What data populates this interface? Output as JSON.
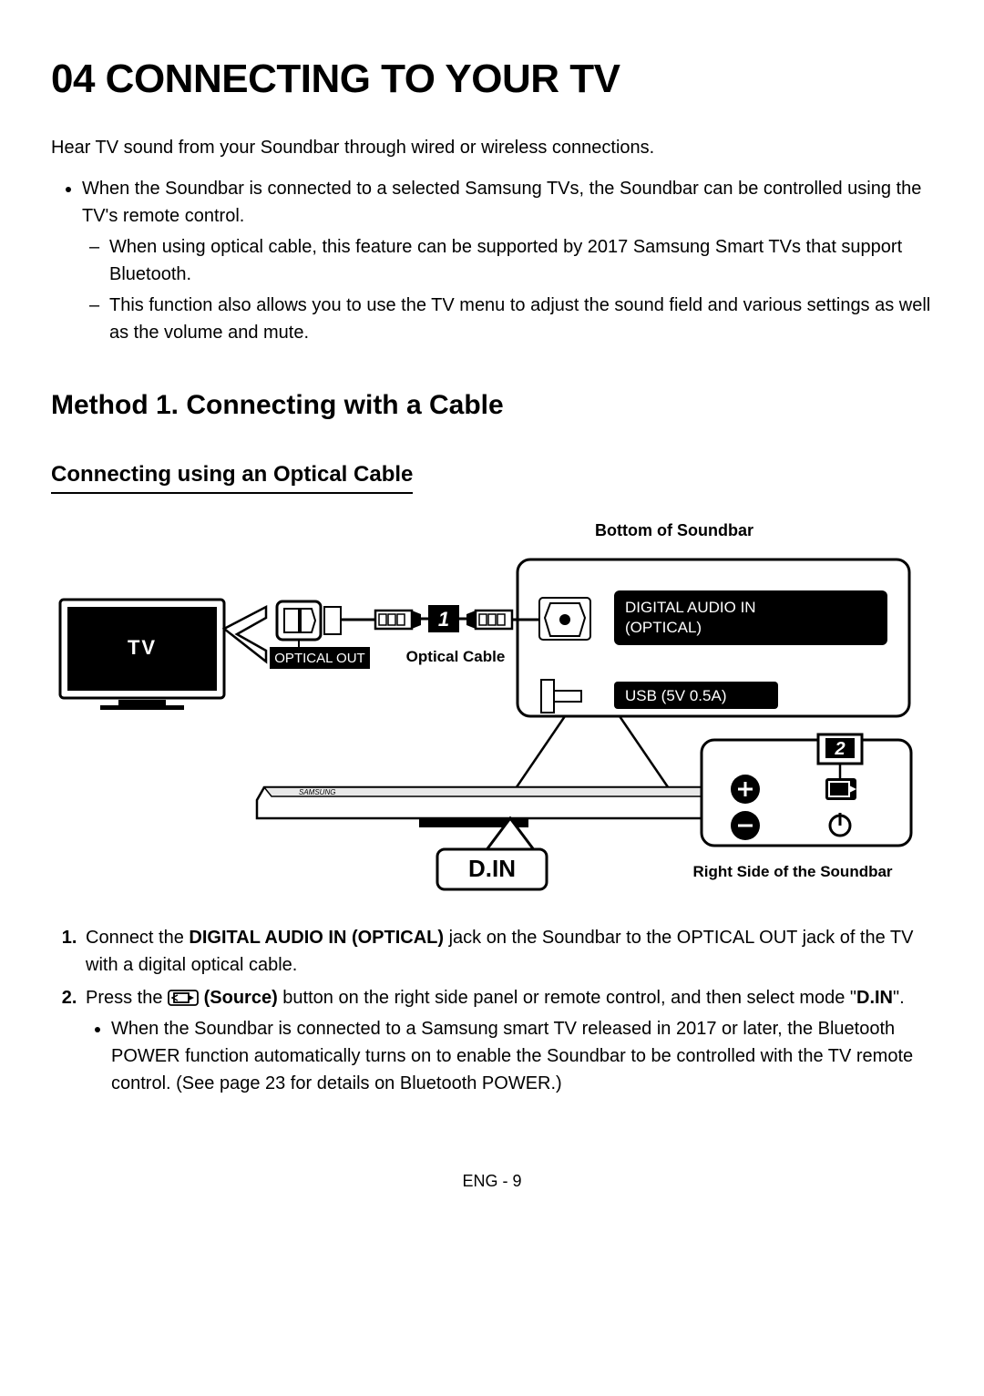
{
  "title": "04   CONNECTING TO YOUR TV",
  "intro": "Hear TV sound from your Soundbar through wired or wireless connections.",
  "bullets": {
    "main": "When the Soundbar is connected to a selected Samsung TVs, the Soundbar can be controlled using the TV's remote control.",
    "dash1": "When using optical cable, this feature can be supported by 2017 Samsung Smart TVs that support Bluetooth.",
    "dash2": "This function also allows you to use the TV menu to adjust the sound field and various settings as well as the volume and mute."
  },
  "method_title": "Method 1. Connecting with a Cable",
  "sub_title": "Connecting using an Optical Cable",
  "diagram": {
    "top_label": "Bottom of Soundbar",
    "tv_label": "TV",
    "optical_out": "OPTICAL OUT",
    "cable_label": "Optical Cable",
    "callout_1": "1",
    "digital_audio_in": "DIGITAL AUDIO IN (OPTICAL)",
    "usb": "USB (5V 0.5A)",
    "callout_2": "2",
    "din": "D.IN",
    "right_side": "Right Side of the Soundbar"
  },
  "steps": {
    "s1_pre": "Connect the ",
    "s1_bold": "DIGITAL AUDIO IN (OPTICAL)",
    "s1_post": " jack on the Soundbar to the OPTICAL OUT jack of the TV with a digital optical cable.",
    "s2_pre": "Press the ",
    "s2_bold": " (Source)",
    "s2_mid": " button on the right side panel or remote control, and then select mode \"",
    "s2_din": "D.IN",
    "s2_end": "\".",
    "s2_bullet": "When the Soundbar is connected to a Samsung smart TV released in 2017 or later, the Bluetooth POWER function automatically turns on to enable the Soundbar to be controlled with the TV remote control. (See page 23 for details on Bluetooth POWER.)"
  },
  "footer": "ENG - 9"
}
